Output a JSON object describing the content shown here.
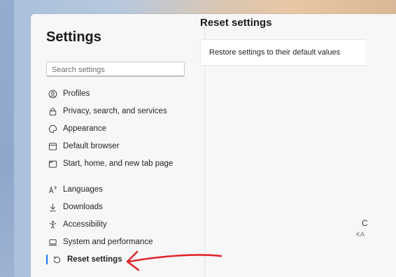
{
  "sidebar": {
    "title": "Settings",
    "search_placeholder": "Search settings",
    "items": [
      {
        "label": "Profiles",
        "icon": "profile-icon"
      },
      {
        "label": "Privacy, search, and services",
        "icon": "lock-icon"
      },
      {
        "label": "Appearance",
        "icon": "appearance-icon"
      },
      {
        "label": "Default browser",
        "icon": "browser-icon"
      },
      {
        "label": "Start, home, and new tab page",
        "icon": "home-tab-icon"
      },
      {
        "label": "Languages",
        "icon": "languages-icon"
      },
      {
        "label": "Downloads",
        "icon": "download-icon"
      },
      {
        "label": "Accessibility",
        "icon": "accessibility-icon"
      },
      {
        "label": "System and performance",
        "icon": "laptop-icon"
      },
      {
        "label": "Reset settings",
        "icon": "reset-icon",
        "active": true
      }
    ]
  },
  "main": {
    "title": "Reset settings",
    "restore_label": "Restore settings to their default values"
  },
  "edge_text": {
    "c": "C",
    "ka": "KA"
  },
  "colors": {
    "accent": "#1a73e8",
    "annotation_arrow": "#e0262c"
  }
}
